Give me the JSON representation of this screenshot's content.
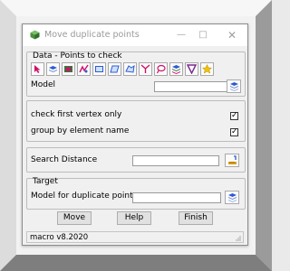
{
  "window": {
    "title": "Move duplicate points"
  },
  "data_group": {
    "label": "Data  - Points to check",
    "tools": [
      "pointer-icon",
      "layers-icon",
      "model-icon",
      "selection-icon",
      "rectangle-icon",
      "parallelogram-icon",
      "polygon-icon",
      "funnel-icon",
      "lasso-icon",
      "stack-icon",
      "filter-icon",
      "star-icon"
    ],
    "model_label": "Model",
    "model_value": ""
  },
  "options_group": {
    "check_first_vertex_label": "check first vertex only",
    "check_first_vertex_checked": true,
    "group_by_name_label": "group by element name",
    "group_by_name_checked": true
  },
  "search_group": {
    "label": "Search Distance",
    "value": ""
  },
  "target_group": {
    "label": "Target",
    "model_label": "Model for duplicate points",
    "model_value": ""
  },
  "buttons": {
    "move": "Move",
    "help": "Help",
    "finish": "Finish"
  },
  "status": {
    "text": "macro v8.2020"
  },
  "colors": {
    "accent_pink": "#d0106a",
    "accent_blue": "#2d5bd1",
    "star": "#f2c300"
  }
}
